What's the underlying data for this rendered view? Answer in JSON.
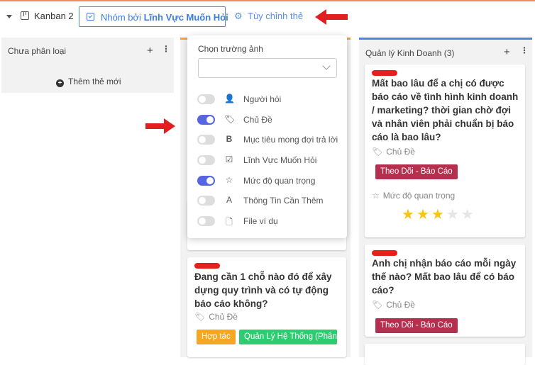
{
  "toolbar": {
    "view_name": "Kanban 2",
    "group_prefix": "Nhóm bởi",
    "group_field": "Lĩnh Vực Muốn Hỏi",
    "customize_label": "Tùy chỉnh thẻ"
  },
  "columns": [
    {
      "title": "Chưa phân loại",
      "add_card_label": "Thêm thẻ mới"
    },
    {
      "title": ""
    },
    {
      "title": "Quản lý Kinh Doanh (3)"
    }
  ],
  "dropdown": {
    "label": "Chọn trường ảnh",
    "select_value": "",
    "options": [
      {
        "label": "Người hỏi",
        "enabled": false,
        "icon": "person-icon"
      },
      {
        "label": "Chủ Đề",
        "enabled": true,
        "icon": "tag-icon"
      },
      {
        "label": "Mục tiêu mong đợi trả lời",
        "enabled": false,
        "icon": "bold-icon"
      },
      {
        "label": "Lĩnh Vực Muốn Hỏi",
        "enabled": false,
        "icon": "select-icon"
      },
      {
        "label": "Mức độ quan trọng",
        "enabled": true,
        "icon": "star-icon"
      },
      {
        "label": "Thông Tin Cần Thêm",
        "enabled": false,
        "icon": "text-icon"
      },
      {
        "label": "File ví dụ",
        "enabled": false,
        "icon": "file-icon"
      }
    ]
  },
  "cards": {
    "middle": {
      "title": "Đang cần 1 chỗ nào đó để xây dựng quy trình và có tự động báo cáo không?",
      "topic_label": "Chủ Đề",
      "tags": [
        "Hợp tác",
        "Quản Lý Hệ Thống (Phân Q"
      ]
    },
    "right1": {
      "title": "Mất bao lâu để a chị có được báo cáo về tình hình kinh doanh / marketing? thời gian chờ đợi và nhân viên phải chuẩn bị báo cáo là bao lâu?",
      "topic_label": "Chủ Đề",
      "tag": "Theo Dõi - Báo Cáo",
      "importance_label": "Mức độ quan trọng",
      "rating": 3,
      "rating_max": 5
    },
    "right2": {
      "title": "Anh chị nhận báo cáo mỗi ngày thế nào? Mất bao lâu để có báo cáo?",
      "topic_label": "Chủ Đề",
      "tag": "Theo Dõi - Báo Cáo"
    }
  },
  "colors": {
    "accent": "#4a86e8",
    "toggle_on": "#5566e0",
    "tag_red": "#b5304f",
    "tag_orange": "#f5a623",
    "tag_green": "#2ecc71",
    "marker_red": "#e8201a",
    "arrow_red": "#e02020"
  }
}
